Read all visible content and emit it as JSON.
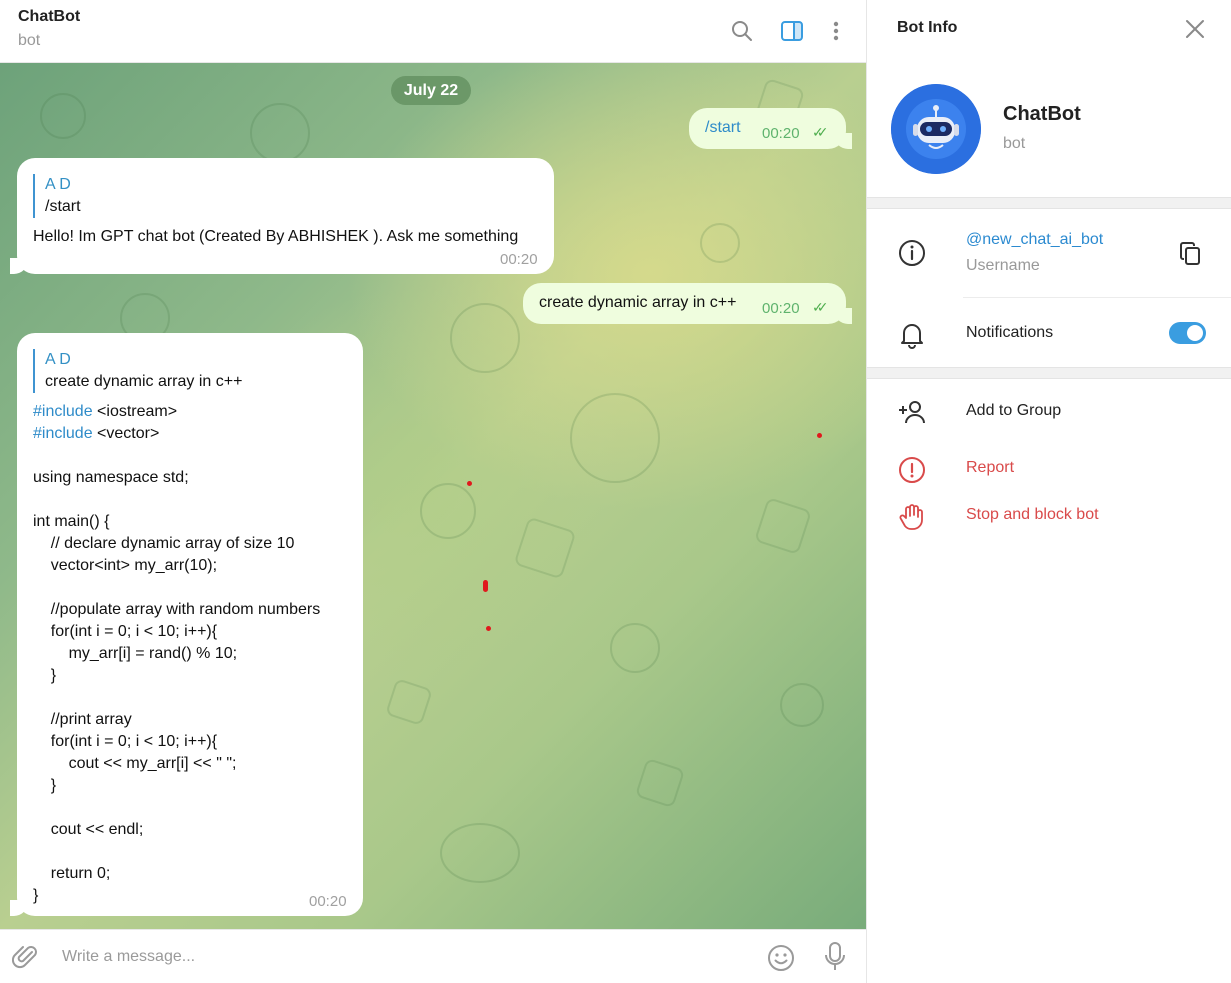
{
  "chat": {
    "title": "ChatBot",
    "subtitle": "bot",
    "header_icons": [
      "search-icon",
      "sidebar-toggle-icon",
      "more-vertical-icon"
    ],
    "date_separator": "July 22",
    "messages": [
      {
        "direction": "out",
        "text": "/start",
        "time": "00:20",
        "status": "read"
      },
      {
        "direction": "in",
        "reply_name": "A D",
        "reply_text": "/start",
        "text": "Hello! Im GPT chat bot (Created By ABHISHEK ). Ask me something",
        "time": "00:20"
      },
      {
        "direction": "out",
        "text": "create dynamic array in c++",
        "time": "00:20",
        "status": "read"
      },
      {
        "direction": "in",
        "reply_name": "A D",
        "reply_text": "create dynamic array in c++",
        "code_lines": [
          "#include <iostream>",
          "#include <vector>",
          "",
          "using namespace std;",
          "",
          "int main() {",
          "    // declare dynamic array of size 10",
          "    vector<int> my_arr(10);",
          "",
          "    //populate array with random numbers",
          "    for(int i = 0; i < 10; i++){",
          "        my_arr[i] = rand() % 10;",
          "    }",
          "",
          "    //print array",
          "    for(int i = 0; i < 10; i++){",
          "        cout << my_arr[i] << \" \";",
          "    }",
          "",
          "    cout << endl;",
          "",
          "    return 0;",
          "}"
        ],
        "time": "00:20"
      }
    ],
    "composer": {
      "placeholder": "Write a message...",
      "icons": [
        "attach-icon",
        "emoji-icon",
        "microphone-icon"
      ]
    }
  },
  "info": {
    "title": "Bot Info",
    "name": "ChatBot",
    "subtitle": "bot",
    "username": "@new_chat_ai_bot",
    "username_caption": "Username",
    "notifications_label": "Notifications",
    "notifications_enabled": true,
    "add_to_group": "Add to Group",
    "report": "Report",
    "stop_block": "Stop and block bot",
    "colors": {
      "accent": "#3a9de0",
      "danger": "#d94a4a",
      "outgoing_bubble": "#effdde",
      "avatar": "#2b6fe0"
    }
  }
}
